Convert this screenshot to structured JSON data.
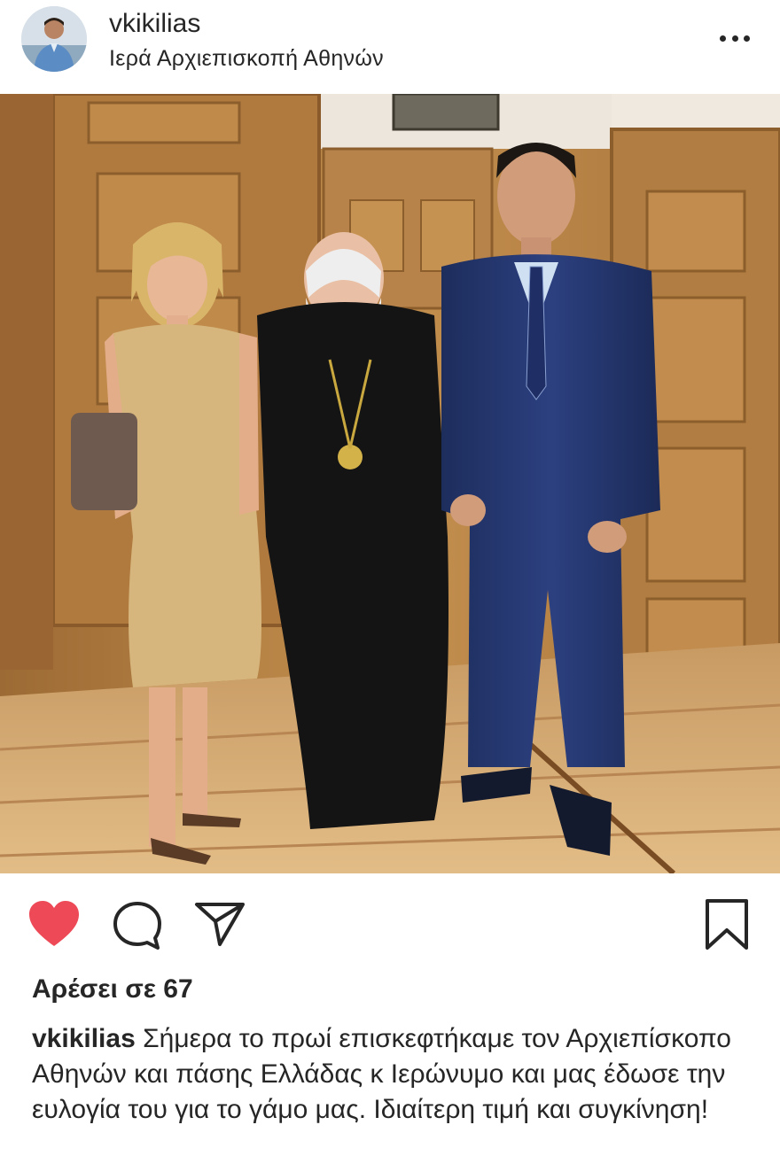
{
  "post": {
    "username": "vkikilias",
    "location": "Ιερά Αρχιεπισκοπή Αθηνών",
    "likes_text": "Αρέσει σε 67",
    "caption_username": "vkikilias",
    "caption_text": "Σήμερα το πρωί επισκεφτήκαμε τον Αρχιεπίσκοπο Αθηνών και πάσης Ελλάδας κ Ιερώνυμο και μας έδωσε την ευλογία του για το γάμο μας. Ιδιαίτερη τιμή και συγκίνηση!",
    "liked": true
  },
  "icons": {
    "more": "more-options-icon",
    "like": "heart-icon",
    "comment": "comment-icon",
    "share": "share-icon",
    "save": "bookmark-icon"
  },
  "colors": {
    "like_red": "#ed4956",
    "text": "#262626",
    "background": "#ffffff"
  }
}
